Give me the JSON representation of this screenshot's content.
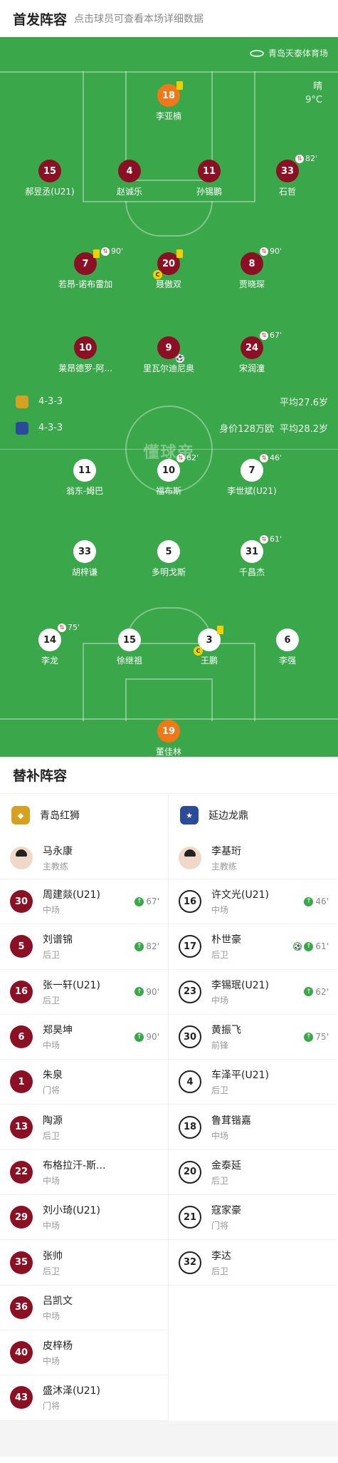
{
  "header": {
    "title": "首发阵容",
    "subtitle": "点击球员可查看本场详细数据"
  },
  "pitch": {
    "venue": "青岛天泰体育场",
    "weather": "晴",
    "temperature": "9°C",
    "watermark": "懂球帝",
    "home_bar": {
      "formation": "4-3-3",
      "avg_age": "平均27.6岁"
    },
    "away_bar": {
      "formation": "4-3-3",
      "value": "身价128万欧",
      "avg_age": "平均28.2岁"
    }
  },
  "home_players": [
    {
      "num": "18",
      "name": "李亚楠",
      "kind": "gk",
      "yellow": true
    },
    {
      "num": "15",
      "name": "郝昱丞(U21)",
      "kind": "home"
    },
    {
      "num": "4",
      "name": "赵诚乐",
      "kind": "home"
    },
    {
      "num": "11",
      "name": "孙锡鹏",
      "kind": "home"
    },
    {
      "num": "33",
      "name": "石哲",
      "kind": "home",
      "sub_min": "82'"
    },
    {
      "num": "7",
      "name": "若昂-诺布雷加",
      "kind": "home",
      "yellow": true,
      "sub_min": "90'"
    },
    {
      "num": "20",
      "name": "聂傲双",
      "kind": "home",
      "yellow": true,
      "captain": true
    },
    {
      "num": "8",
      "name": "贾晓琛",
      "kind": "home",
      "sub_min": "90'"
    },
    {
      "num": "10",
      "name": "莱昂德罗-阿...",
      "kind": "home"
    },
    {
      "num": "9",
      "name": "里瓦尔迪尼奥",
      "kind": "home",
      "goal": true
    },
    {
      "num": "24",
      "name": "宋润潼",
      "kind": "home",
      "sub_min": "67'"
    }
  ],
  "away_players": [
    {
      "num": "11",
      "name": "翁东-姆巴",
      "kind": "away"
    },
    {
      "num": "10",
      "name": "福布斯",
      "kind": "away",
      "sub_min": "62'"
    },
    {
      "num": "7",
      "name": "李世斌(U21)",
      "kind": "away",
      "sub_min": "46'"
    },
    {
      "num": "33",
      "name": "胡梓谦",
      "kind": "away"
    },
    {
      "num": "5",
      "name": "多明戈斯",
      "kind": "away"
    },
    {
      "num": "31",
      "name": "千昌杰",
      "kind": "away",
      "sub_min": "61'"
    },
    {
      "num": "14",
      "name": "李龙",
      "kind": "away",
      "sub_min": "75'"
    },
    {
      "num": "15",
      "name": "徐继祖",
      "kind": "away"
    },
    {
      "num": "3",
      "name": "王鹏",
      "kind": "away",
      "yellow": true,
      "captain": true
    },
    {
      "num": "6",
      "name": "李强",
      "kind": "away"
    },
    {
      "num": "19",
      "name": "董佳林",
      "kind": "gk"
    }
  ],
  "subs_title": "替补阵容",
  "home_team": {
    "name": "青岛红狮",
    "color": "#d8a020",
    "coach": {
      "name": "马永康",
      "role": "主教练"
    },
    "subs": [
      {
        "num": "30",
        "name": "周建燚(U21)",
        "pos": "中场",
        "min": "67'"
      },
      {
        "num": "5",
        "name": "刘谱锦",
        "pos": "后卫",
        "min": "82'"
      },
      {
        "num": "16",
        "name": "张一轩(U21)",
        "pos": "后卫",
        "min": "90'"
      },
      {
        "num": "6",
        "name": "郑昊坤",
        "pos": "中场",
        "min": "90'"
      },
      {
        "num": "1",
        "name": "朱泉",
        "pos": "门将"
      },
      {
        "num": "13",
        "name": "陶源",
        "pos": "后卫"
      },
      {
        "num": "22",
        "name": "布格拉汗-斯...",
        "pos": "中场"
      },
      {
        "num": "29",
        "name": "刘小琦(U21)",
        "pos": "中场"
      },
      {
        "num": "35",
        "name": "张帅",
        "pos": "后卫"
      },
      {
        "num": "36",
        "name": "吕凯文",
        "pos": "中场"
      },
      {
        "num": "40",
        "name": "皮梓杨",
        "pos": "中场"
      },
      {
        "num": "43",
        "name": "盛沐泽(U21)",
        "pos": "门将"
      }
    ]
  },
  "away_team": {
    "name": "延边龙鼎",
    "color": "#2a4a9a",
    "coach": {
      "name": "李基珩",
      "role": "主教练"
    },
    "subs": [
      {
        "num": "16",
        "name": "许文光(U21)",
        "pos": "中场",
        "min": "46'"
      },
      {
        "num": "17",
        "name": "朴世豪",
        "pos": "后卫",
        "min": "61'",
        "goal": true
      },
      {
        "num": "23",
        "name": "李锡珉(U21)",
        "pos": "中场",
        "min": "62'"
      },
      {
        "num": "30",
        "name": "黄振飞",
        "pos": "前锋",
        "min": "75'"
      },
      {
        "num": "4",
        "name": "车泽平(U21)",
        "pos": "后卫"
      },
      {
        "num": "18",
        "name": "鲁茸锴嘉",
        "pos": "中场"
      },
      {
        "num": "20",
        "name": "金泰延",
        "pos": "后卫"
      },
      {
        "num": "21",
        "name": "寇家豪",
        "pos": "门将"
      },
      {
        "num": "32",
        "name": "李达",
        "pos": "后卫"
      }
    ]
  }
}
